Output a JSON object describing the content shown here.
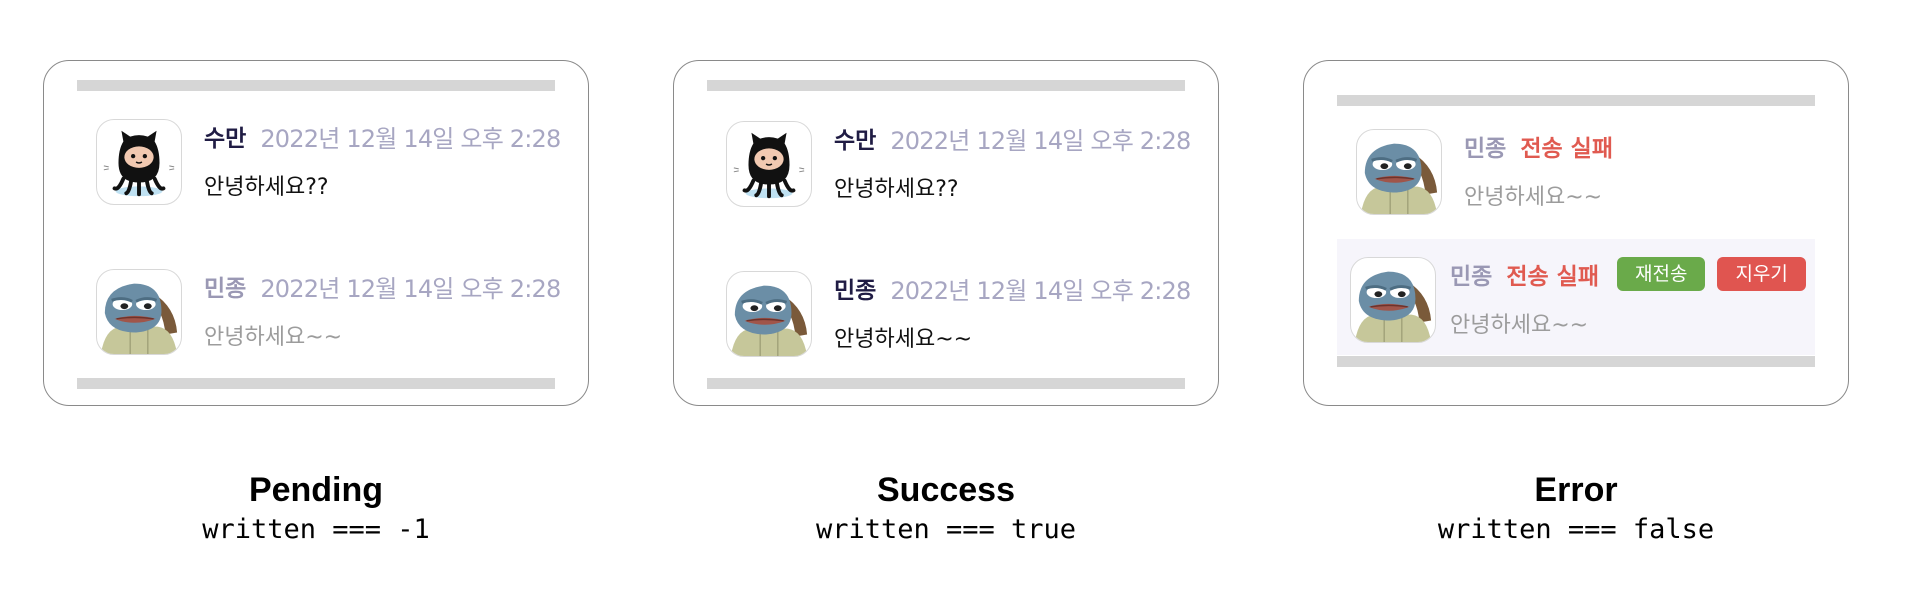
{
  "panels": [
    {
      "title": "Pending",
      "condition": "written === -1",
      "messages": [
        {
          "name": "수만",
          "time": "2022년 12월 14일 오후 2:28",
          "text": "안녕하세요??",
          "avatar": "octocat-icon"
        },
        {
          "name": "민종",
          "time": "2022년 12월 14일 오후 2:28",
          "text": "안녕하세요~~",
          "avatar": "turtle-icon"
        }
      ]
    },
    {
      "title": "Success",
      "condition": "written === true",
      "messages": [
        {
          "name": "수만",
          "time": "2022년 12월 14일 오후 2:28",
          "text": "안녕하세요??",
          "avatar": "octocat-icon"
        },
        {
          "name": "민종",
          "time": "2022년 12월 14일 오후 2:28",
          "text": "안녕하세요~~",
          "avatar": "turtle-icon"
        }
      ]
    },
    {
      "title": "Error",
      "condition": "written === false",
      "messages": [
        {
          "name": "민종",
          "status": "전송 실패",
          "text": "안녕하세요~~",
          "avatar": "turtle-icon"
        },
        {
          "name": "민종",
          "status": "전송 실패",
          "text": "안녕하세요~~",
          "avatar": "turtle-icon",
          "retry_label": "재전송",
          "delete_label": "지우기"
        }
      ]
    }
  ],
  "colors": {
    "name": "#201c44",
    "name_dim": "#9a98b4",
    "time": "#a7a6c2",
    "fail": "#e05a50",
    "retry_button": "#6aaa4a",
    "delete_button": "#e05550",
    "panel_border": "#8a8a8a",
    "bar": "#d6d6d6"
  }
}
